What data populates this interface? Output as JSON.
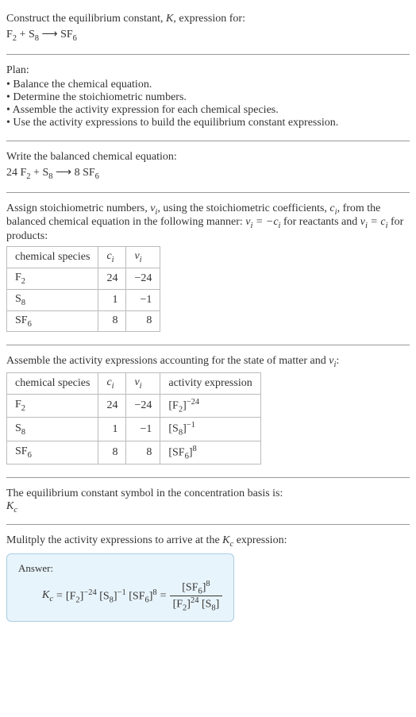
{
  "header": {
    "line1": "Construct the equilibrium constant, K, expression for:",
    "equation": "F₂ + S₈ ⟶ SF₆"
  },
  "plan": {
    "title": "Plan:",
    "items": [
      "Balance the chemical equation.",
      "Determine the stoichiometric numbers.",
      "Assemble the activity expression for each chemical species.",
      "Use the activity expressions to build the equilibrium constant expression."
    ]
  },
  "balanced": {
    "intro": "Write the balanced chemical equation:",
    "equation": "24 F₂ + S₈ ⟶ 8 SF₆"
  },
  "stoich": {
    "intro_a": "Assign stoichiometric numbers, ",
    "intro_b": ", using the stoichiometric coefficients, ",
    "intro_c": ", from the balanced chemical equation in the following manner: ",
    "intro_d": " for reactants and ",
    "intro_e": " for products:",
    "nu_i": "νᵢ",
    "c_i": "cᵢ",
    "rel_react": "νᵢ = −cᵢ",
    "rel_prod": "νᵢ = cᵢ",
    "headers": [
      "chemical species",
      "cᵢ",
      "νᵢ"
    ],
    "rows": [
      {
        "species": "F₂",
        "c": "24",
        "nu": "−24"
      },
      {
        "species": "S₈",
        "c": "1",
        "nu": "−1"
      },
      {
        "species": "SF₆",
        "c": "8",
        "nu": "8"
      }
    ]
  },
  "activity": {
    "intro_a": "Assemble the activity expressions accounting for the state of matter and ",
    "intro_b": ":",
    "nu_i": "νᵢ",
    "headers": [
      "chemical species",
      "cᵢ",
      "νᵢ",
      "activity expression"
    ],
    "rows": [
      {
        "species": "F₂",
        "c": "24",
        "nu": "−24",
        "act": "[F₂]⁻²⁴"
      },
      {
        "species": "S₈",
        "c": "1",
        "nu": "−1",
        "act": "[S₈]⁻¹"
      },
      {
        "species": "SF₆",
        "c": "8",
        "nu": "8",
        "act": "[SF₆]⁸"
      }
    ]
  },
  "symbol": {
    "intro": "The equilibrium constant symbol in the concentration basis is:",
    "k": "K",
    "c": "c"
  },
  "multiply": {
    "intro_a": "Mulitply the activity expressions to arrive at the ",
    "intro_b": " expression:",
    "k": "K",
    "c": "c"
  },
  "answer": {
    "label": "Answer:",
    "lhs_k": "K",
    "lhs_c": "c",
    "eq": " = ",
    "product": "[F₂]⁻²⁴ [S₈]⁻¹ [SF₆]⁸",
    "frac_num": "[SF₆]⁸",
    "frac_den": "[F₂]²⁴ [S₈]"
  },
  "chart_data": {
    "type": "table",
    "tables": [
      {
        "title": "stoichiometric numbers",
        "columns": [
          "chemical species",
          "c_i",
          "nu_i"
        ],
        "rows": [
          [
            "F2",
            24,
            -24
          ],
          [
            "S8",
            1,
            -1
          ],
          [
            "SF6",
            8,
            8
          ]
        ]
      },
      {
        "title": "activity expressions",
        "columns": [
          "chemical species",
          "c_i",
          "nu_i",
          "activity expression"
        ],
        "rows": [
          [
            "F2",
            24,
            -24,
            "[F2]^-24"
          ],
          [
            "S8",
            1,
            -1,
            "[S8]^-1"
          ],
          [
            "SF6",
            8,
            8,
            "[SF6]^8"
          ]
        ]
      }
    ]
  }
}
